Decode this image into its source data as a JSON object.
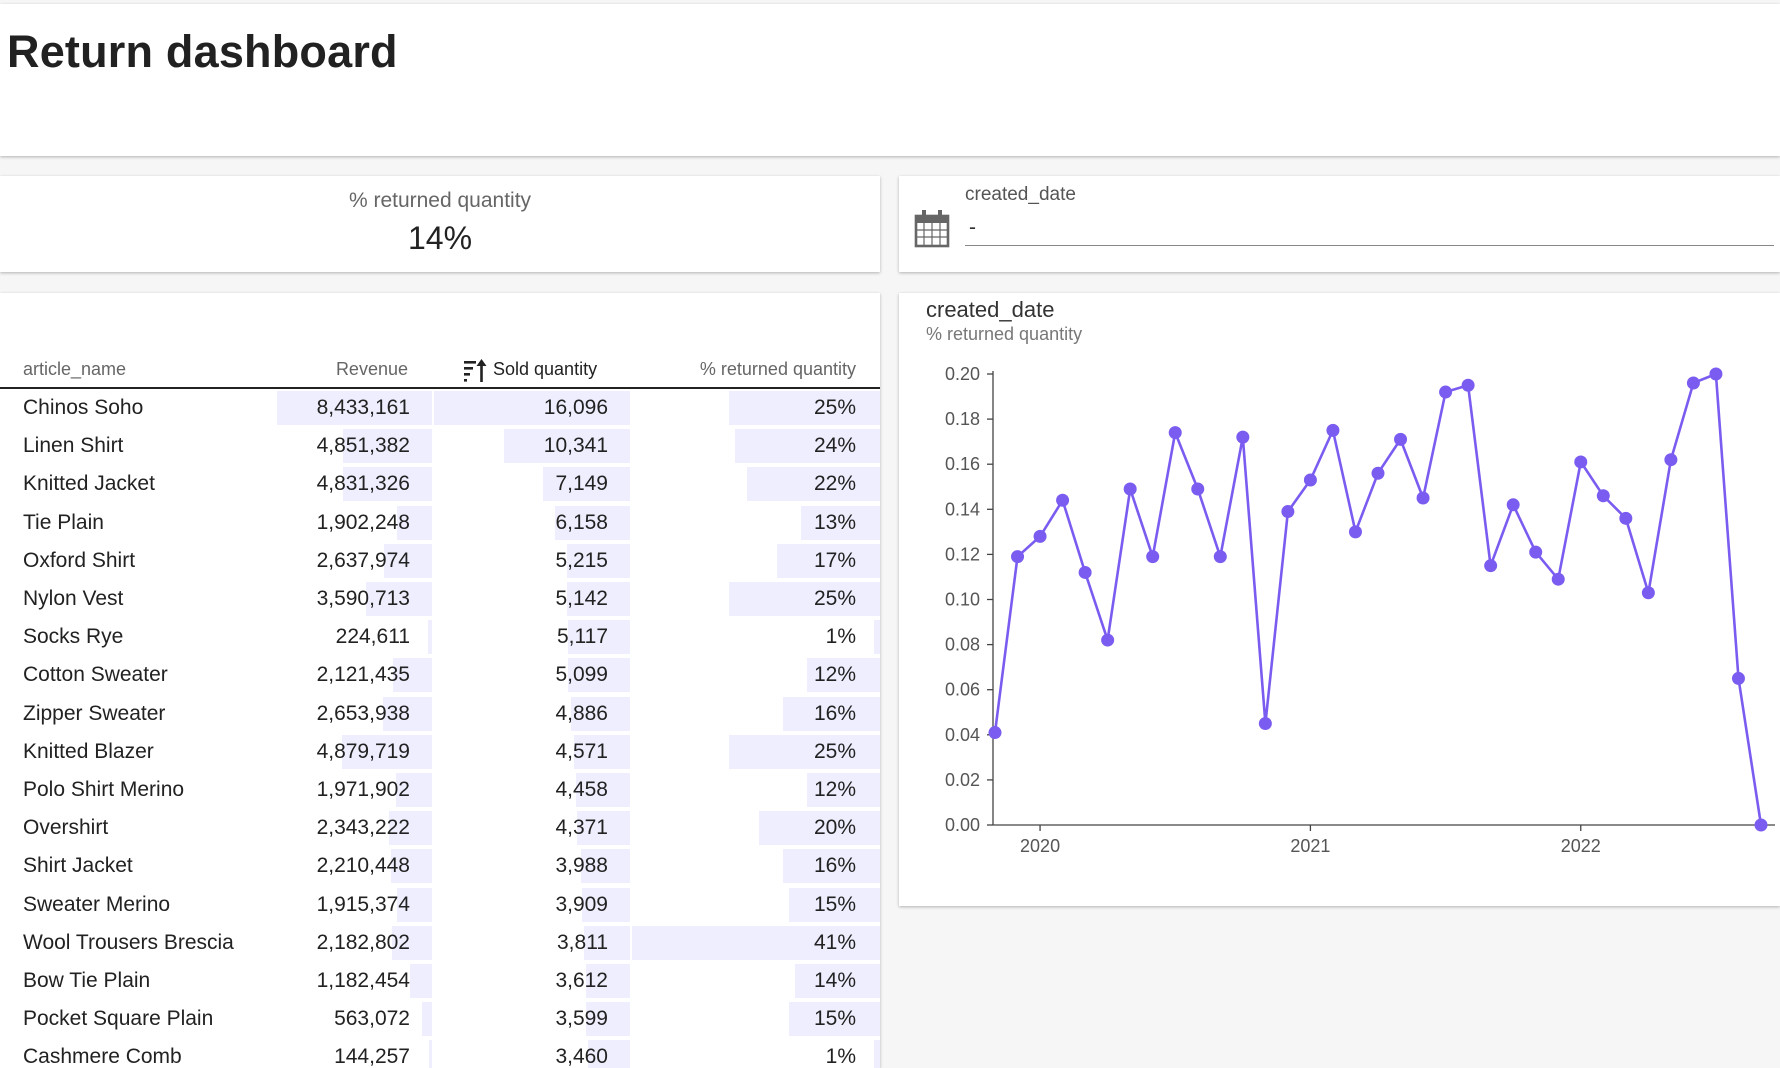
{
  "header": {
    "title": "Return dashboard"
  },
  "kpi": {
    "label": "% returned quantity",
    "value": "14%"
  },
  "date_filter": {
    "label": "created_date",
    "value": "-",
    "icon": "calendar-icon"
  },
  "table": {
    "columns": [
      "article_name",
      "Revenue",
      "Sold quantity",
      "% returned quantity"
    ],
    "sort_icon": "sort-descending-icon",
    "bar_color": "#efeefe",
    "rows": [
      {
        "name": "Chinos Soho",
        "revenue": "8,433,161",
        "sold": "16,096",
        "returned": "25%",
        "revenue_n": 8433161,
        "sold_n": 16096,
        "returned_n": 25
      },
      {
        "name": "Linen Shirt",
        "revenue": "4,851,382",
        "sold": "10,341",
        "returned": "24%",
        "revenue_n": 4851382,
        "sold_n": 10341,
        "returned_n": 24
      },
      {
        "name": "Knitted Jacket",
        "revenue": "4,831,326",
        "sold": "7,149",
        "returned": "22%",
        "revenue_n": 4831326,
        "sold_n": 7149,
        "returned_n": 22
      },
      {
        "name": "Tie Plain",
        "revenue": "1,902,248",
        "sold": "6,158",
        "returned": "13%",
        "revenue_n": 1902248,
        "sold_n": 6158,
        "returned_n": 13
      },
      {
        "name": "Oxford Shirt",
        "revenue": "2,637,974",
        "sold": "5,215",
        "returned": "17%",
        "revenue_n": 2637974,
        "sold_n": 5215,
        "returned_n": 17
      },
      {
        "name": "Nylon Vest",
        "revenue": "3,590,713",
        "sold": "5,142",
        "returned": "25%",
        "revenue_n": 3590713,
        "sold_n": 5142,
        "returned_n": 25
      },
      {
        "name": "Socks Rye",
        "revenue": "224,611",
        "sold": "5,117",
        "returned": "1%",
        "revenue_n": 224611,
        "sold_n": 5117,
        "returned_n": 1
      },
      {
        "name": "Cotton Sweater",
        "revenue": "2,121,435",
        "sold": "5,099",
        "returned": "12%",
        "revenue_n": 2121435,
        "sold_n": 5099,
        "returned_n": 12
      },
      {
        "name": "Zipper Sweater",
        "revenue": "2,653,938",
        "sold": "4,886",
        "returned": "16%",
        "revenue_n": 2653938,
        "sold_n": 4886,
        "returned_n": 16
      },
      {
        "name": "Knitted Blazer",
        "revenue": "4,879,719",
        "sold": "4,571",
        "returned": "25%",
        "revenue_n": 4879719,
        "sold_n": 4571,
        "returned_n": 25
      },
      {
        "name": "Polo Shirt Merino",
        "revenue": "1,971,902",
        "sold": "4,458",
        "returned": "12%",
        "revenue_n": 1971902,
        "sold_n": 4458,
        "returned_n": 12
      },
      {
        "name": "Overshirt",
        "revenue": "2,343,222",
        "sold": "4,371",
        "returned": "20%",
        "revenue_n": 2343222,
        "sold_n": 4371,
        "returned_n": 20
      },
      {
        "name": "Shirt Jacket",
        "revenue": "2,210,448",
        "sold": "3,988",
        "returned": "16%",
        "revenue_n": 2210448,
        "sold_n": 3988,
        "returned_n": 16
      },
      {
        "name": "Sweater Merino",
        "revenue": "1,915,374",
        "sold": "3,909",
        "returned": "15%",
        "revenue_n": 1915374,
        "sold_n": 3909,
        "returned_n": 15
      },
      {
        "name": "Wool Trousers Brescia",
        "revenue": "2,182,802",
        "sold": "3,811",
        "returned": "41%",
        "revenue_n": 2182802,
        "sold_n": 3811,
        "returned_n": 41
      },
      {
        "name": "Bow Tie Plain",
        "revenue": "1,182,454",
        "sold": "3,612",
        "returned": "14%",
        "revenue_n": 1182454,
        "sold_n": 3612,
        "returned_n": 14
      },
      {
        "name": "Pocket Square Plain",
        "revenue": "563,072",
        "sold": "3,599",
        "returned": "15%",
        "revenue_n": 563072,
        "sold_n": 3599,
        "returned_n": 15
      },
      {
        "name": "Cashmere Comb",
        "revenue": "144,257",
        "sold": "3,460",
        "returned": "1%",
        "revenue_n": 144257,
        "sold_n": 3460,
        "returned_n": 1
      }
    ]
  },
  "chart": {
    "title": "created_date",
    "subtitle": "% returned quantity",
    "color": "#7b5cf0"
  },
  "chart_data": {
    "type": "line",
    "title": "created_date",
    "ylabel": "% returned quantity",
    "xlabel": "",
    "ylim": [
      0,
      0.2
    ],
    "yticks": [
      "0.00",
      "0.02",
      "0.04",
      "0.06",
      "0.08",
      "0.10",
      "0.12",
      "0.14",
      "0.16",
      "0.18",
      "0.20"
    ],
    "xtick_labels": [
      "2020",
      "2021",
      "2022"
    ],
    "x": [
      "2019-11",
      "2019-12",
      "2020-01",
      "2020-02",
      "2020-03",
      "2020-04",
      "2020-05",
      "2020-06",
      "2020-07",
      "2020-08",
      "2020-09",
      "2020-10",
      "2020-11",
      "2020-12",
      "2021-01",
      "2021-02",
      "2021-03",
      "2021-04",
      "2021-05",
      "2021-06",
      "2021-07",
      "2021-08",
      "2021-09",
      "2021-10",
      "2021-11",
      "2021-12",
      "2022-01",
      "2022-02",
      "2022-03",
      "2022-04",
      "2022-05",
      "2022-06",
      "2022-07",
      "2022-08",
      "2022-09",
      "2022-10"
    ],
    "series": [
      {
        "values": [
          0.041,
          0.119,
          0.128,
          0.144,
          0.112,
          0.082,
          0.149,
          0.119,
          0.174,
          0.149,
          0.119,
          0.172,
          0.045,
          0.139,
          0.153,
          0.175,
          0.13,
          0.156,
          0.171,
          0.145,
          0.192,
          0.195,
          0.115,
          0.142,
          0.121,
          0.109,
          0.161,
          0.146,
          0.136,
          0.103,
          0.162,
          0.196,
          0.2,
          0.065,
          0.0
        ]
      }
    ]
  }
}
